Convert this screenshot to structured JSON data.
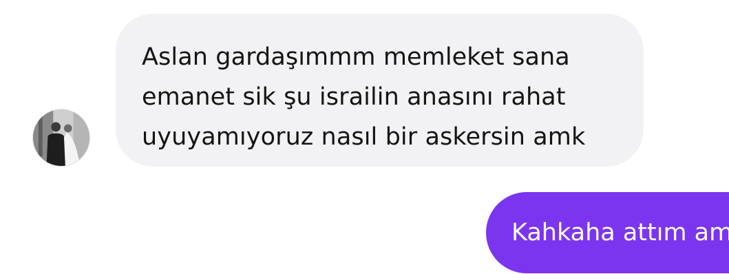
{
  "conversation": {
    "incoming_message": {
      "avatar_icon": "contact-avatar-photo",
      "text": "Aslan gardaşımmm memleket sana\nemanet sik şu israilin anasını rahat\nuyuyamıyoruz nasıl bir askersin amk",
      "bubble_color": "#f2f2f4"
    },
    "outgoing_message": {
      "text": "Kahkaha attım amk",
      "bubble_color": "#7b35ef"
    }
  }
}
